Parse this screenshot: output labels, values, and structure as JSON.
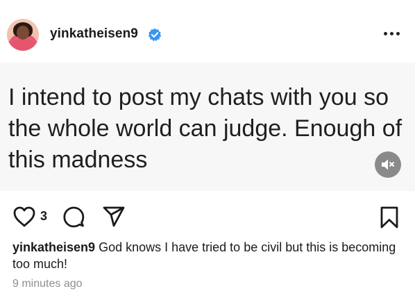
{
  "header": {
    "username": "yinkatheisen9",
    "verified": true,
    "more_icon": "more-horizontal-icon"
  },
  "media": {
    "text": "I intend to post my chats with you so the whole world can judge. Enough of this madness",
    "mute_icon": "muted-speaker-icon"
  },
  "actions": {
    "like_count": "3",
    "icons": [
      "heart-icon",
      "comment-icon",
      "share-icon",
      "bookmark-icon"
    ]
  },
  "caption": {
    "username": "yinkatheisen9",
    "text": "God knows I have tried to be civil  but this is becoming too much!"
  },
  "timestamp": "9 minutes ago",
  "colors": {
    "verified": "#3897f0",
    "timestamp": "#8e8e8e",
    "media_background": "#f7f7f7",
    "mute_button": "#8a8a8a"
  }
}
